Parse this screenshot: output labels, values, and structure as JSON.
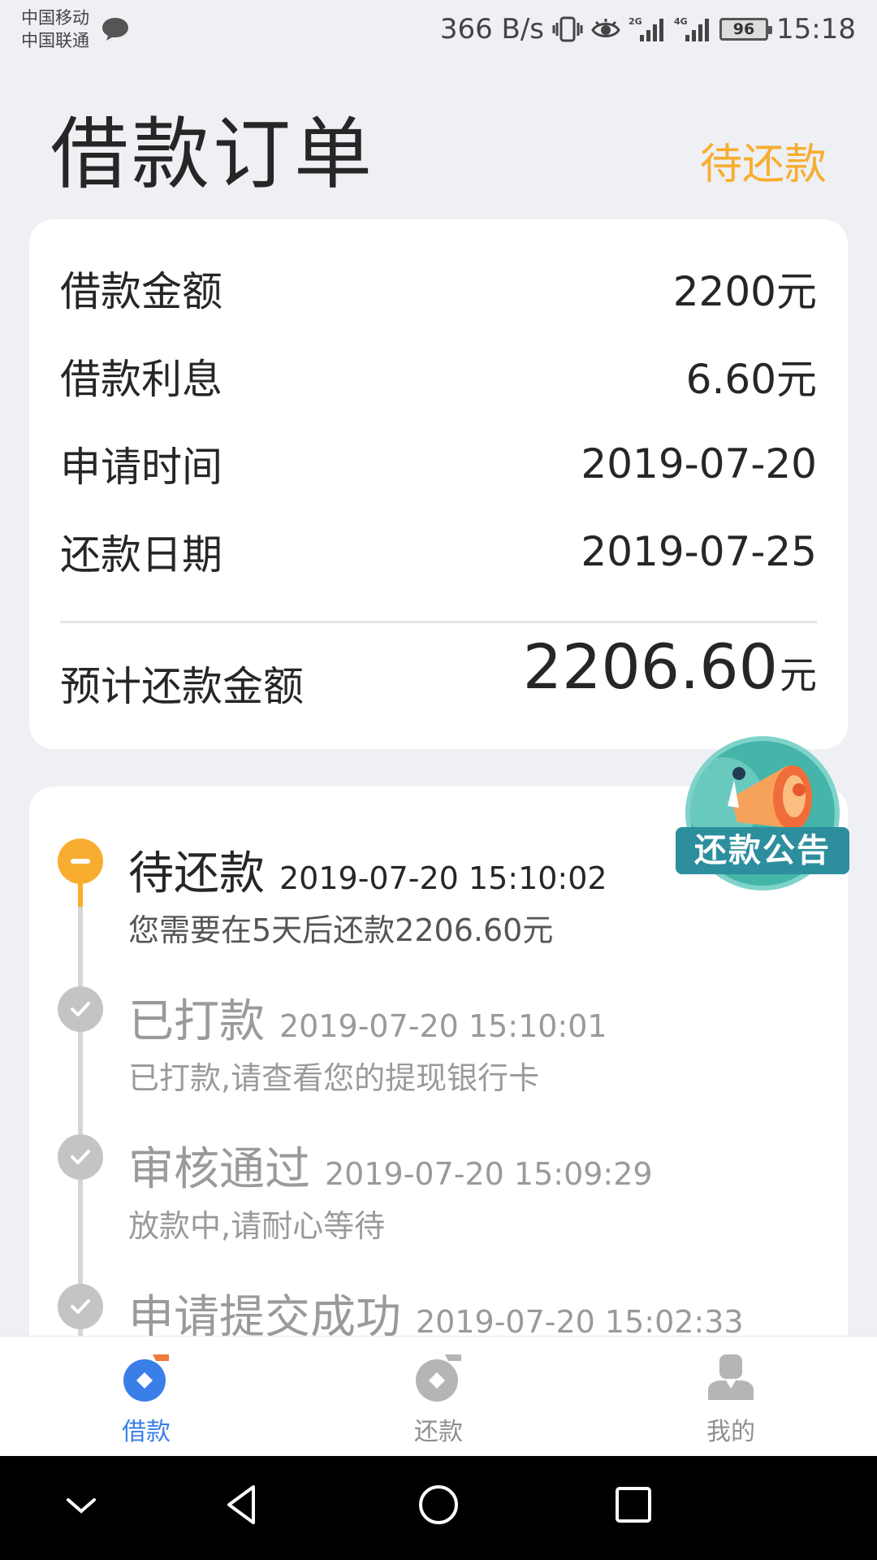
{
  "status_bar": {
    "carrier_1": "中国移动",
    "carrier_2": "中国联通",
    "net_speed": "366 B/s",
    "signal_1": "2G",
    "signal_2": "4G",
    "battery": "96",
    "time": "15:18"
  },
  "header": {
    "title": "借款订单",
    "status": "待还款"
  },
  "summary": {
    "rows": [
      {
        "label": "借款金额",
        "value": "2200元"
      },
      {
        "label": "借款利息",
        "value": "6.60元"
      },
      {
        "label": "申请时间",
        "value": "2019-07-20"
      },
      {
        "label": "还款日期",
        "value": "2019-07-25"
      }
    ],
    "total_label": "预计还款金额",
    "total_value": "2206.60",
    "total_unit": "元"
  },
  "announcement": {
    "label": "还款公告",
    "icon": "megaphone-icon"
  },
  "timeline": [
    {
      "title": "待还款",
      "time": "2019-07-20 15:10:02",
      "desc": "您需要在5天后还款2206.60元",
      "state": "current"
    },
    {
      "title": "已打款",
      "time": "2019-07-20 15:10:01",
      "desc": "已打款,请查看您的提现银行卡",
      "state": "done"
    },
    {
      "title": "审核通过",
      "time": "2019-07-20 15:09:29",
      "desc": "放款中,请耐心等待",
      "state": "done"
    },
    {
      "title": "申请提交成功",
      "time": "2019-07-20 15:02:33",
      "desc": "",
      "state": "done"
    }
  ],
  "tabs": [
    {
      "label": "借款",
      "icon": "loan-icon",
      "active": true
    },
    {
      "label": "还款",
      "icon": "repay-icon",
      "active": false
    },
    {
      "label": "我的",
      "icon": "profile-icon",
      "active": false
    }
  ],
  "colors": {
    "accent": "#f8ad30",
    "tab_active": "#3a7ee8",
    "announce": "#2d8e9d"
  }
}
